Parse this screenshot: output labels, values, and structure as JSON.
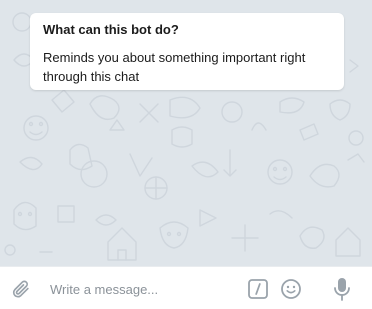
{
  "bot_info": {
    "title": "What can this bot do?",
    "description": "Reminds you about something important right through this chat"
  },
  "composer": {
    "placeholder": "Write a message...",
    "icons": {
      "attach": "paperclip-icon",
      "commands": "slash-commands-icon",
      "emoji": "smiley-icon",
      "voice": "microphone-icon"
    }
  },
  "colors": {
    "chat_background": "#dfe5ea",
    "doodle_stroke": "#cfd6dd",
    "icon_gray": "#9aa3ab",
    "card_background": "#ffffff"
  }
}
